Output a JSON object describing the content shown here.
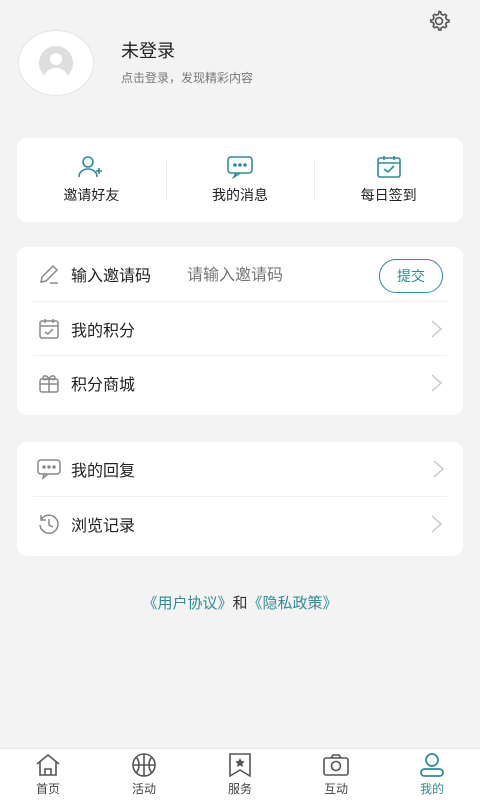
{
  "profile": {
    "name": "未登录",
    "subtitle": "点击登录，发现精彩内容"
  },
  "quick_actions": [
    {
      "label": "邀请好友",
      "icon": "add-user-icon"
    },
    {
      "label": "我的消息",
      "icon": "message-icon"
    },
    {
      "label": "每日签到",
      "icon": "calendar-check-icon"
    }
  ],
  "invite": {
    "label": "输入邀请码",
    "placeholder": "请输入邀请码",
    "submit_label": "提交"
  },
  "menu1": [
    {
      "label": "我的积分",
      "icon": "points-icon"
    },
    {
      "label": "积分商城",
      "icon": "gift-icon"
    }
  ],
  "menu2": [
    {
      "label": "我的回复",
      "icon": "reply-icon"
    },
    {
      "label": "浏览记录",
      "icon": "history-icon"
    }
  ],
  "agreement": {
    "user_agreement": "《用户协议》",
    "and": "和",
    "privacy_policy": "《隐私政策》"
  },
  "tabs": [
    {
      "label": "首页",
      "icon": "home-icon"
    },
    {
      "label": "活动",
      "icon": "basketball-icon"
    },
    {
      "label": "服务",
      "icon": "bookmark-star-icon"
    },
    {
      "label": "互动",
      "icon": "camera-icon"
    },
    {
      "label": "我的",
      "icon": "user-icon",
      "active": true
    }
  ],
  "colors": {
    "accent": "#2f8c94",
    "background": "#f3f3f3"
  }
}
